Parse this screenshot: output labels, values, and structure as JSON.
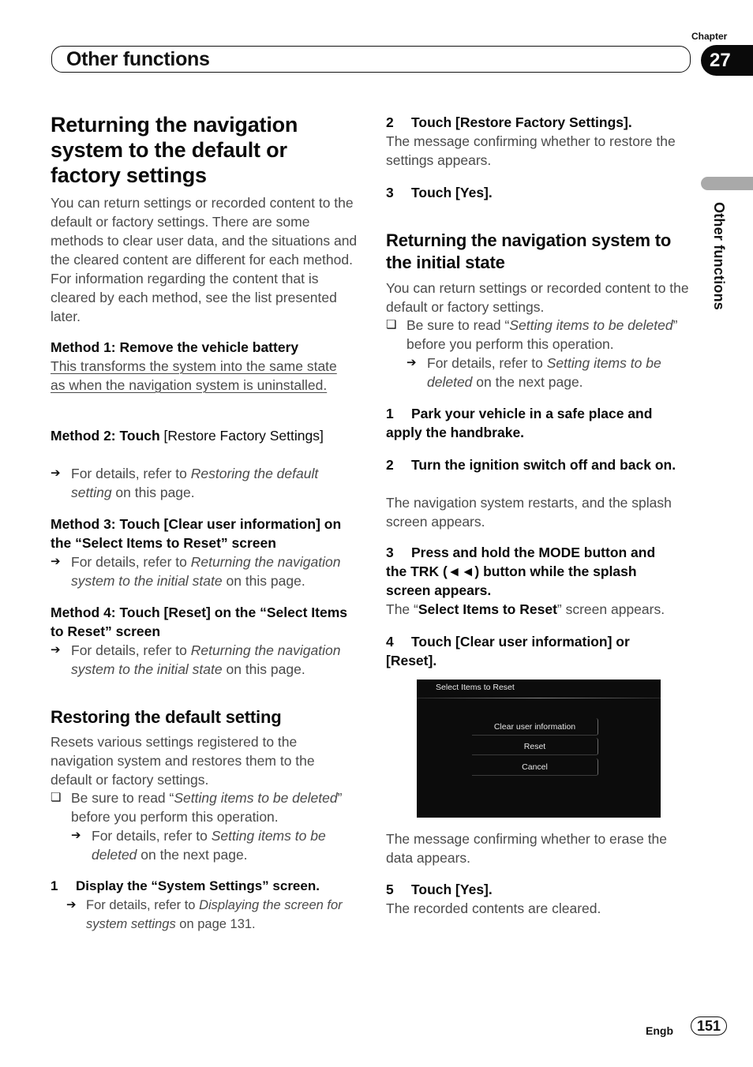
{
  "header": {
    "section_title": "Other functions",
    "chapter_label": "Chapter",
    "chapter_number": "27"
  },
  "side_tab": {
    "label": "Other functions"
  },
  "left": {
    "main_title": "Returning the navigation system to the default or factory settings",
    "intro": "You can return settings or recorded content to the default or factory settings. There are some methods to clear user data, and the situations and the cleared content are different for each method. For information regarding the content that is cleared by each method, see the list presented later.",
    "method1": {
      "heading": "Method 1: Remove the vehicle battery",
      "text": "This transforms the system into the same state as when the navigation system is uninstalled."
    },
    "method2": {
      "heading_a": "Method 2: Touch ",
      "heading_b": "[Restore Factory Settings]",
      "ref_prefix": "For details, refer to ",
      "ref_italic": "Restoring the default setting",
      "ref_suffix": " on this page."
    },
    "method3": {
      "heading_a": "Method 3: Touch ",
      "heading_b": "[Clear user information]",
      "heading_c": " on the “",
      "heading_d": "Select Items to Reset",
      "heading_e": "” screen",
      "ref_prefix": "For details, refer to ",
      "ref_italic": "Returning the navigation system to the initial state",
      "ref_suffix": " on this page."
    },
    "method4": {
      "heading_a": "Method 4: Touch [Reset] on the “",
      "heading_b": "Select Items to Reset",
      "heading_c": "” screen",
      "ref_prefix": "For details, refer to ",
      "ref_italic": "Returning the navigation system to the initial state",
      "ref_suffix": " on this page."
    },
    "restoring": {
      "title": "Restoring the default setting",
      "text": "Resets various settings registered to the navigation system and restores them to the default or factory settings.",
      "note_prefix": "Be sure to read “",
      "note_italic": "Setting items to be deleted",
      "note_suffix": "” before you perform this operation.",
      "sub_prefix": "For details, refer to ",
      "sub_italic": "Setting items to be deleted",
      "sub_suffix": " on the next page.",
      "step1_num": "1",
      "step1": "Display the “System Settings” screen.",
      "step1_ref_prefix": "For details, refer to ",
      "step1_ref_italic": "Displaying the screen for system settings",
      "step1_ref_suffix": " on page 131."
    }
  },
  "right": {
    "step2_num": "2",
    "step2": "Touch [Restore Factory Settings].",
    "step2_text": "The message confirming whether to restore the settings appears.",
    "step3_num": "3",
    "step3": "Touch [Yes].",
    "initial": {
      "title": "Returning the navigation system to the initial state",
      "text": "You can return settings or recorded content to the default or factory settings.",
      "note_prefix": "Be sure to read “",
      "note_italic": "Setting items to be deleted",
      "note_suffix": "” before you perform this operation.",
      "sub_prefix": "For details, refer to ",
      "sub_italic": "Setting items to be deleted",
      "sub_suffix": " on the next page.",
      "s1_num": "1",
      "s1": "Park your vehicle in a safe place and apply the handbrake.",
      "s2_num": "2",
      "s2": "Turn the ignition switch off and back on.",
      "s2_text": "The navigation system restarts, and the splash screen appears.",
      "s3_num": "3",
      "s3": "Press and hold the MODE button and the TRK (◄◄) button while the splash screen appears.",
      "s3_text_a": "The “",
      "s3_text_b": "Select Items to Reset",
      "s3_text_c": "” screen appears.",
      "s4_num": "4",
      "s4": "Touch [Clear user information] or [Reset].",
      "after_screen": "The message confirming whether to erase the data appears.",
      "s5_num": "5",
      "s5": "Touch [Yes].",
      "s5_text": "The recorded contents are cleared."
    },
    "screen": {
      "title": "Select Items to Reset",
      "buttons": [
        "Clear user information",
        "Reset",
        "Cancel"
      ]
    }
  },
  "footer": {
    "lang": "Engb",
    "page": "151"
  },
  "icons": {
    "arrow": "➔",
    "checkbox": "❏"
  }
}
